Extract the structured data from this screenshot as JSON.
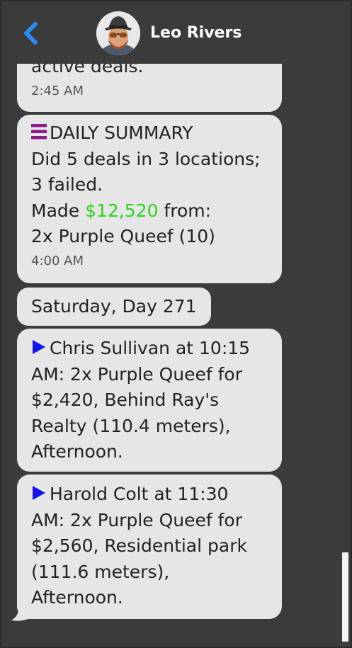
{
  "header": {
    "contact_name": "Leo Rivers"
  },
  "messages": {
    "m1": {
      "text_tail": "active deals.",
      "time": "2:45 AM"
    },
    "m2": {
      "title": "DAILY SUMMARY",
      "line1": "Did 5 deals in 3 locations;",
      "line2": "3 failed.",
      "made_prefix": "Made ",
      "made_amount": "$12,520",
      "made_suffix": " from:",
      "line4": "2x Purple Queef (10)",
      "time": "4:00 AM"
    },
    "date_divider": "Saturday, Day 271",
    "m3": {
      "line1": "Chris Sullivan at 10:15",
      "line2": "AM: 2x Purple Queef for",
      "line3": "$2,420, Behind Ray's",
      "line4": "Realty (110.4 meters),",
      "line5": "Afternoon."
    },
    "m4": {
      "line1": "Harold Colt at 11:30",
      "line2": "AM: 2x Purple Queef for",
      "line3": "$2,560, Residential park",
      "line4": "(111.6 meters),",
      "line5": "Afternoon."
    }
  },
  "colors": {
    "accent_blue": "#2b8cf0",
    "money_green": "#2fd21f",
    "menu_purple": "#8a1b8a",
    "play_blue": "#1414e6"
  },
  "icons": {
    "back": "chevron-left-icon",
    "summary": "menu-icon",
    "deal": "play-icon"
  }
}
